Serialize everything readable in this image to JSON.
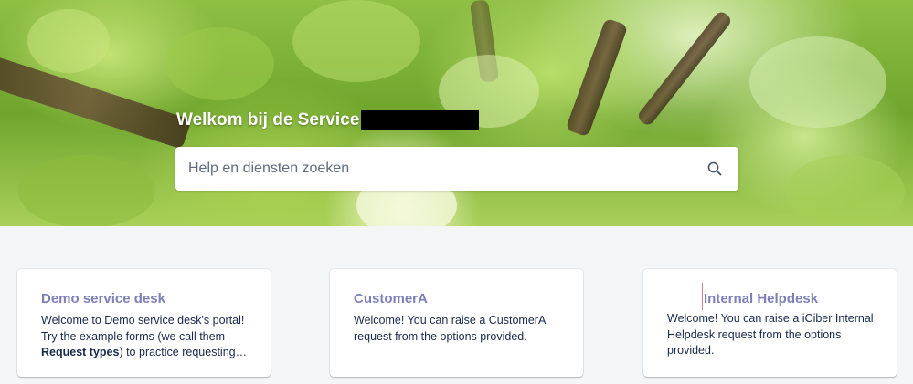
{
  "hero": {
    "title": "Welkom bij de Service D"
  },
  "search": {
    "placeholder": "Help en diensten zoeken",
    "icon": "search-icon"
  },
  "cards": [
    {
      "title": "Demo service desk",
      "desc_before": "Welcome to Demo service desk's portal! Try the example forms (we call them ",
      "desc_bold": "Request types",
      "desc_after": ") to practice requesting…"
    },
    {
      "title": "CustomerA",
      "desc": "Welcome! You can raise a CustomerA request from the options provided."
    },
    {
      "title": "Internal Helpdesk",
      "desc": "Welcome! You can raise a iCiber Internal Helpdesk request from the options provided."
    }
  ],
  "colors": {
    "card_title": "#7d80b8",
    "page_background": "#f4f5f7",
    "text": "#172b4d"
  }
}
